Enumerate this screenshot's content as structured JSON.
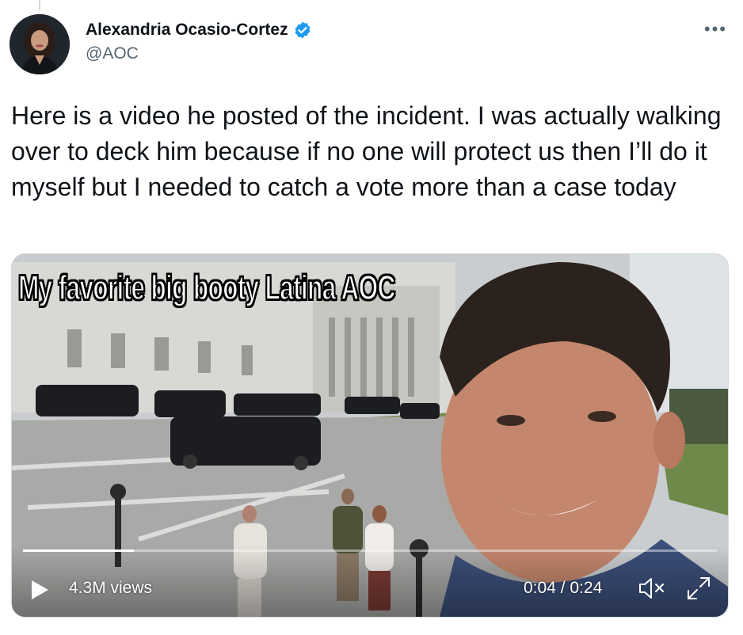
{
  "author": {
    "display_name": "Alexandria Ocasio-Cortez",
    "handle": "@AOC",
    "verified_icon": "verified-badge-icon",
    "avatar_icon": "avatar"
  },
  "menu": {
    "more_label": "•••"
  },
  "tweet": {
    "text": "Here is a video he posted of the incident. I was actually walking over to deck him because if no one will protect us then I’ll do it myself but I needed to catch a vote more than a case today"
  },
  "video": {
    "caption": "My favorite big booty Latina AOC",
    "views": "4.3M views",
    "time": "0:04 / 0:24",
    "progress": 0.16,
    "icons": [
      "play-icon",
      "mute-icon",
      "fullscreen-icon"
    ]
  },
  "colors": {
    "accent": "#1d9bf0",
    "text": "#0f1419",
    "secondary": "#536471"
  }
}
